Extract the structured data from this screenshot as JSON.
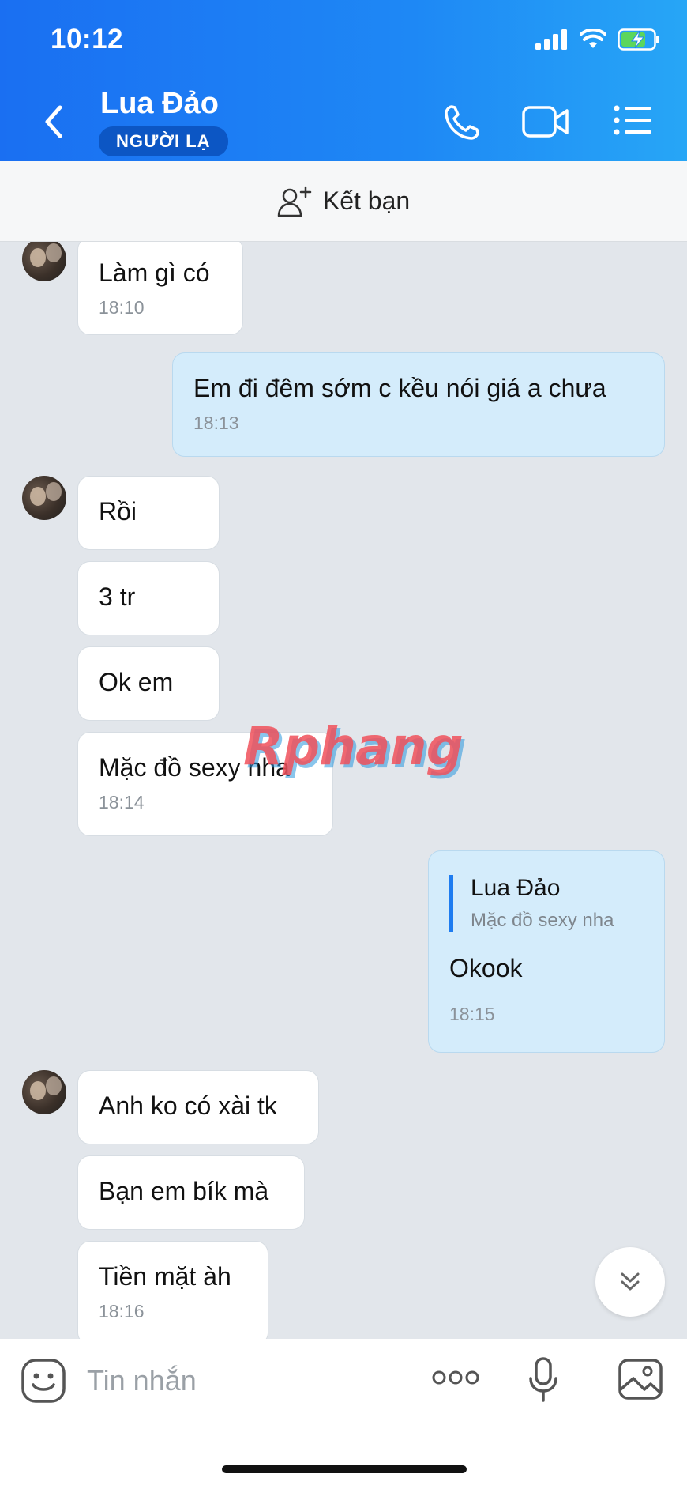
{
  "status_bar": {
    "time": "10:12"
  },
  "header": {
    "contact_name": "Lua Đảo",
    "badge": "NGƯỜI LẠ"
  },
  "add_friend": {
    "label": "Kết bạn"
  },
  "messages": [
    {
      "side": "them",
      "text": "Làm gì có",
      "time": "18:10"
    },
    {
      "side": "me",
      "text": "Em đi đêm sớm c kều nói giá a chưa",
      "time": "18:13"
    },
    {
      "side": "them",
      "text": "Rồi"
    },
    {
      "side": "them",
      "text": "3 tr"
    },
    {
      "side": "them",
      "text": "Ok em"
    },
    {
      "side": "them",
      "text": "Mặc đồ sexy nha",
      "time": "18:14"
    },
    {
      "side": "me",
      "quote_name": "Lua Đảo",
      "quote_text": "Mặc đồ sexy nha",
      "text": "Okook",
      "time": "18:15"
    },
    {
      "side": "them",
      "text": "Anh ko có xài tk"
    },
    {
      "side": "them",
      "text": "Bạn em bík mà"
    },
    {
      "side": "them",
      "text": "Tiền mặt àh",
      "time": "18:16"
    }
  ],
  "watermark": "Rphang",
  "input": {
    "placeholder": "Tin nhắn"
  },
  "colors": {
    "header_start": "#1a6ff2",
    "header_end": "#27a6f6",
    "my_bubble": "#d4ecfb",
    "background": "#e2e6eb"
  }
}
